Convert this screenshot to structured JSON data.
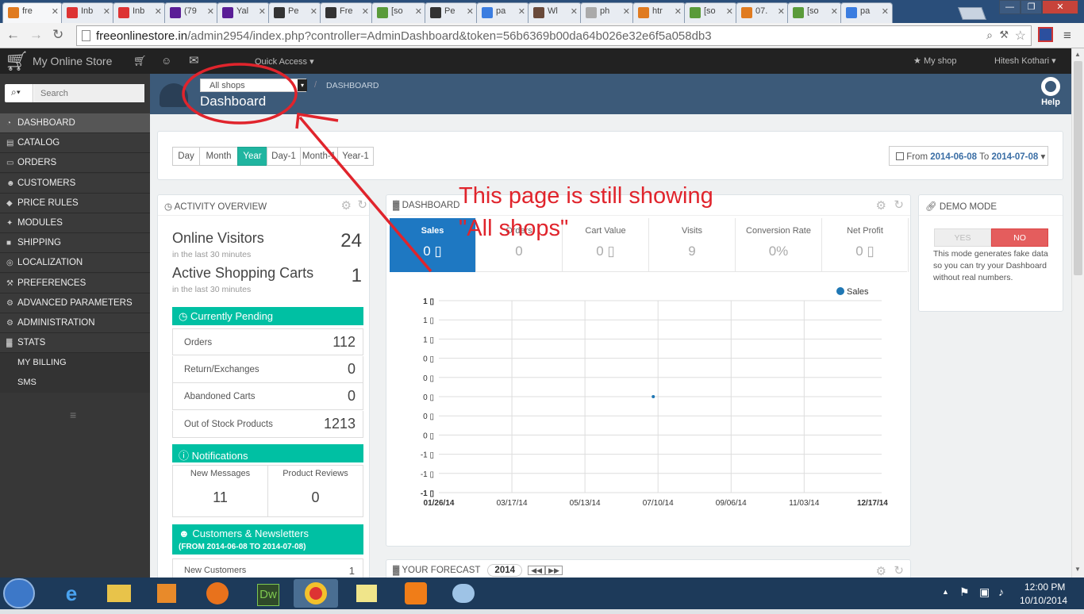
{
  "browser": {
    "tabs": [
      {
        "label": "fre",
        "icon": "prestashop-favicon-icon",
        "color": "#e07b20",
        "active": true
      },
      {
        "label": "Inb",
        "icon": "gmail-favicon-icon",
        "color": "#d33"
      },
      {
        "label": "Inb",
        "icon": "gmail-favicon-icon",
        "color": "#d33"
      },
      {
        "label": "(79",
        "icon": "yahoo-mail-favicon-icon",
        "color": "#5a1e96"
      },
      {
        "label": "Yal",
        "icon": "yahoo-favicon-icon",
        "color": "#5a1e96"
      },
      {
        "label": "Pe",
        "icon": "page-favicon-icon",
        "color": "#333"
      },
      {
        "label": "Fre",
        "icon": "page-favicon-icon",
        "color": "#333"
      },
      {
        "label": "[so",
        "icon": "stackexchange-favicon-icon",
        "color": "#5a9b3a"
      },
      {
        "label": "Pe",
        "icon": "page-favicon-icon",
        "color": "#333"
      },
      {
        "label": "pa",
        "icon": "google-favicon-icon",
        "color": "#3b7de0"
      },
      {
        "label": "Wl",
        "icon": "person-favicon-icon",
        "color": "#6a4a3a"
      },
      {
        "label": "ph",
        "icon": "page-favicon-icon",
        "color": "#aaa"
      },
      {
        "label": "htr",
        "icon": "stackoverflow-favicon-icon",
        "color": "#e07b20"
      },
      {
        "label": "[so",
        "icon": "stackexchange-favicon-icon",
        "color": "#5a9b3a"
      },
      {
        "label": "07.",
        "icon": "rss-favicon-icon",
        "color": "#e07b20"
      },
      {
        "label": "[so",
        "icon": "stackexchange-favicon-icon",
        "color": "#5a9b3a"
      },
      {
        "label": "pa",
        "icon": "google-favicon-icon",
        "color": "#3b7de0"
      }
    ],
    "url_host": "freeonlinestore.in",
    "url_path": "/admin2954/index.php?controller=AdminDashboard&token=56b6369b00da64b026e32e6f5a058db3"
  },
  "header": {
    "store_name": "My Online Store",
    "quick_access": "Quick Access",
    "my_shop": "My shop",
    "user_name": "Hitesh Kothari"
  },
  "search": {
    "placeholder": "Search"
  },
  "sidebar": {
    "items": [
      {
        "label": "DASHBOARD",
        "icon": "dashboard-icon",
        "active": true
      },
      {
        "label": "CATALOG",
        "icon": "book-icon"
      },
      {
        "label": "ORDERS",
        "icon": "credit-card-icon"
      },
      {
        "label": "CUSTOMERS",
        "icon": "users-icon"
      },
      {
        "label": "PRICE RULES",
        "icon": "tags-icon"
      },
      {
        "label": "MODULES",
        "icon": "puzzle-icon"
      },
      {
        "label": "SHIPPING",
        "icon": "truck-icon"
      },
      {
        "label": "LOCALIZATION",
        "icon": "globe-icon"
      },
      {
        "label": "PREFERENCES",
        "icon": "wrench-icon"
      },
      {
        "label": "ADVANCED PARAMETERS",
        "icon": "cogs-icon"
      },
      {
        "label": "ADMINISTRATION",
        "icon": "cog-icon"
      },
      {
        "label": "STATS",
        "icon": "bar-chart-icon"
      }
    ],
    "sub_items": [
      "MY BILLING",
      "SMS"
    ]
  },
  "page_header": {
    "shop_select": "All shops",
    "breadcrumb": "DASHBOARD",
    "title": "Dashboard",
    "help": "Help"
  },
  "period": {
    "buttons": [
      "Day",
      "Month",
      "Year",
      "Day-1",
      "Month-1",
      "Year-1"
    ],
    "selected": "Year",
    "range_from_label": "From",
    "range_from": "2014-06-08",
    "range_to_label": "To",
    "range_to": "2014-07-08"
  },
  "activity": {
    "title": "ACTIVITY OVERVIEW",
    "online_visitors_label": "Online Visitors",
    "online_visitors_sub": "in the last 30 minutes",
    "online_visitors": "24",
    "active_carts_label": "Active Shopping Carts",
    "active_carts_sub": "in the last 30 minutes",
    "active_carts": "1",
    "pending_title": "Currently Pending",
    "pending": [
      {
        "label": "Orders",
        "value": "112"
      },
      {
        "label": "Return/Exchanges",
        "value": "0"
      },
      {
        "label": "Abandoned Carts",
        "value": "0"
      },
      {
        "label": "Out of Stock Products",
        "value": "1213"
      }
    ],
    "notifications_title": "Notifications",
    "new_messages_label": "New Messages",
    "new_messages": "11",
    "product_reviews_label": "Product Reviews",
    "product_reviews": "0",
    "customers_title": "Customers & Newsletters",
    "customers_range": "(FROM 2014-06-08 TO 2014-07-08)",
    "new_customers_label": "New Customers",
    "new_customers": "1"
  },
  "dashboard_panel": {
    "title": "DASHBOARD",
    "kpis": [
      {
        "label": "Sales",
        "value": "0 ▯",
        "active": true
      },
      {
        "label": "Orders",
        "value": "0"
      },
      {
        "label": "Cart Value",
        "value": "0 ▯"
      },
      {
        "label": "Visits",
        "value": "9"
      },
      {
        "label": "Conversion Rate",
        "value": "0%"
      },
      {
        "label": "Net Profit",
        "value": "0 ▯"
      }
    ]
  },
  "chart_data": {
    "type": "line",
    "series": [
      {
        "name": "Sales",
        "color": "#1f77b4",
        "points": [
          {
            "x": "07/08/14",
            "y": 0
          }
        ]
      }
    ],
    "x_ticks": [
      "01/26/14",
      "03/17/14",
      "05/13/14",
      "07/10/14",
      "09/06/14",
      "11/03/14",
      "12/17/14"
    ],
    "y_ticks": [
      "1 ▯",
      "1 ▯",
      "1 ▯",
      "0 ▯",
      "0 ▯",
      "0 ▯",
      "0 ▯",
      "0 ▯",
      "-1 ▯",
      "-1 ▯",
      "-1 ▯"
    ],
    "legend": "top-right",
    "grid": true
  },
  "demo_mode": {
    "title": "DEMO MODE",
    "yes": "YES",
    "no": "NO",
    "description": "This mode generates fake data so you can try your Dashboard without real numbers."
  },
  "forecast": {
    "title": "YOUR FORECAST",
    "year": "2014"
  },
  "annotation": {
    "line1": "This page is still showing",
    "line2": "\"All shops\"",
    "color": "#e0242c"
  },
  "taskbar": {
    "time": "12:00 PM",
    "date": "10/10/2014"
  }
}
